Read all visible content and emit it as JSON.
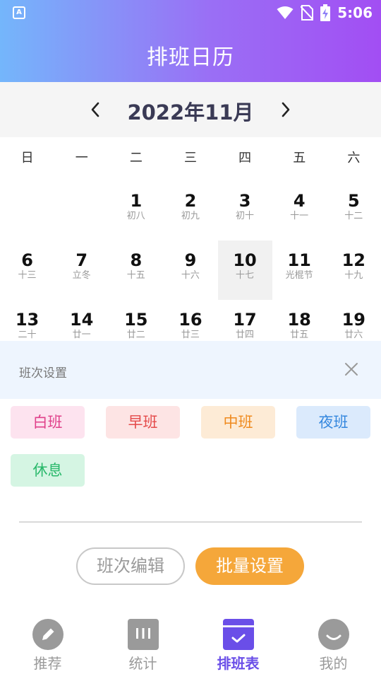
{
  "status": {
    "app_icon_glyph": "A",
    "time": "5:06"
  },
  "header": {
    "title": "排班日历"
  },
  "calendar": {
    "month_label": "2022年11月",
    "weekdays": [
      "日",
      "一",
      "二",
      "三",
      "四",
      "五",
      "六"
    ],
    "weeks": [
      [
        {
          "day": "",
          "lunar": ""
        },
        {
          "day": "",
          "lunar": ""
        },
        {
          "day": "1",
          "lunar": "初八"
        },
        {
          "day": "2",
          "lunar": "初九"
        },
        {
          "day": "3",
          "lunar": "初十"
        },
        {
          "day": "4",
          "lunar": "十一"
        },
        {
          "day": "5",
          "lunar": "十二"
        }
      ],
      [
        {
          "day": "6",
          "lunar": "十三"
        },
        {
          "day": "7",
          "lunar": "立冬"
        },
        {
          "day": "8",
          "lunar": "十五"
        },
        {
          "day": "9",
          "lunar": "十六"
        },
        {
          "day": "10",
          "lunar": "十七",
          "today": true
        },
        {
          "day": "11",
          "lunar": "光棍节"
        },
        {
          "day": "12",
          "lunar": "十九"
        }
      ],
      [
        {
          "day": "13",
          "lunar": "二十"
        },
        {
          "day": "14",
          "lunar": "廿一"
        },
        {
          "day": "15",
          "lunar": "廿二"
        },
        {
          "day": "16",
          "lunar": "廿三"
        },
        {
          "day": "17",
          "lunar": "廿四"
        },
        {
          "day": "18",
          "lunar": "廿五"
        },
        {
          "day": "19",
          "lunar": "廿六"
        }
      ]
    ]
  },
  "shift_panel": {
    "title": "班次设置",
    "shifts": [
      {
        "label": "白班",
        "bg": "#fde3ef",
        "color": "#e0408a"
      },
      {
        "label": "早班",
        "bg": "#fde4e4",
        "color": "#e44a4a"
      },
      {
        "label": "中班",
        "bg": "#fdebd6",
        "color": "#ef8a1e"
      },
      {
        "label": "夜班",
        "bg": "#dbeafc",
        "color": "#3487de"
      },
      {
        "label": "休息",
        "bg": "#d5f5e3",
        "color": "#28b86a"
      }
    ]
  },
  "actions": {
    "edit_label": "班次编辑",
    "batch_label": "批量设置"
  },
  "tabs": [
    {
      "label": "推荐",
      "icon": "pencil-icon"
    },
    {
      "label": "统计",
      "icon": "stats-icon"
    },
    {
      "label": "排班表",
      "icon": "schedule-icon",
      "active": true
    },
    {
      "label": "我的",
      "icon": "profile-icon"
    }
  ],
  "colors": {
    "accent": "#6a4ee8",
    "batch_button": "#f5a73a"
  }
}
